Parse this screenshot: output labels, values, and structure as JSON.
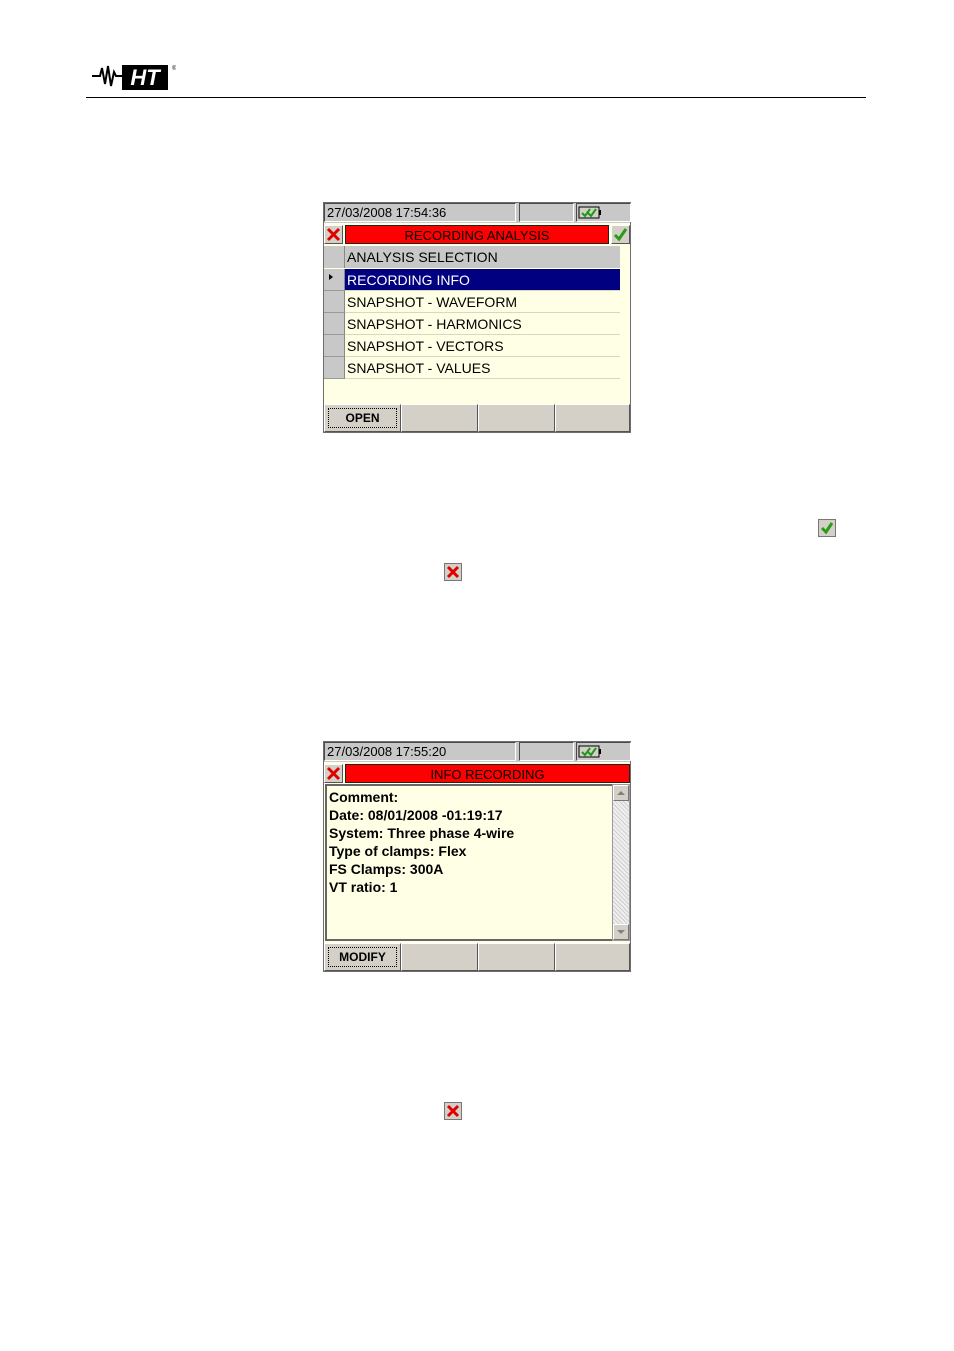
{
  "header": {
    "logo_text": "HT",
    "logo_mark": "®"
  },
  "screen1": {
    "status": {
      "datetime": "27/03/2008 17:54:36"
    },
    "title": "RECORDING ANALYSIS",
    "list_header": "ANALYSIS SELECTION",
    "items": [
      {
        "label": "RECORDING INFO",
        "selected": true
      },
      {
        "label": "SNAPSHOT - WAVEFORM"
      },
      {
        "label": "SNAPSHOT - HARMONICS"
      },
      {
        "label": "SNAPSHOT - VECTORS"
      },
      {
        "label": "SNAPSHOT - VALUES"
      }
    ],
    "fkeys": [
      "OPEN",
      "",
      "",
      ""
    ]
  },
  "screen2": {
    "status": {
      "datetime": "27/03/2008 17:55:20"
    },
    "title": "INFO RECORDING",
    "lines": [
      "Comment:",
      "Date:  08/01/2008 -01:19:17",
      "System:  Three phase 4-wire",
      "Type of clamps:  Flex",
      "FS Clamps:  300A",
      "VT ratio:  1"
    ],
    "fkeys": [
      "MODIFY",
      "",
      "",
      ""
    ]
  },
  "colors": {
    "title_bar": "#ff0000",
    "selection": "#000080",
    "screen_bg": "#ffffe6",
    "check": "#2a9a1a",
    "cross": "#e00000"
  }
}
